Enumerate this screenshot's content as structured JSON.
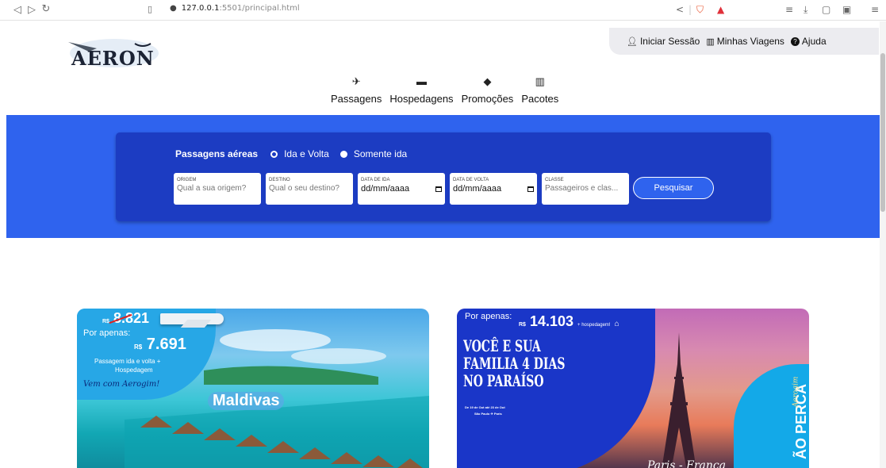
{
  "browser": {
    "url_host": "127.0.0.1",
    "url_path": ":5501/principal.html"
  },
  "topnav": {
    "login": "Iniciar Sessão",
    "trips": "Minhas Viagens",
    "help": "Ajuda"
  },
  "logo": {
    "text": "AERON"
  },
  "tabs": [
    {
      "label": "Passagens",
      "icon": "plane-icon"
    },
    {
      "label": "Hospedagens",
      "icon": "bed-icon"
    },
    {
      "label": "Promoções",
      "icon": "tag-icon"
    },
    {
      "label": "Pacotes",
      "icon": "suitcase-icon"
    }
  ],
  "search": {
    "title": "Passagens aéreas",
    "option_round": "Ida e Volta",
    "option_oneway": "Somente ida",
    "selected": "Somente ida",
    "origin_label": "ORIGEM",
    "origin_placeholder": "Qual a sua origem?",
    "destination_label": "DESTINO",
    "destination_placeholder": "Qual o seu destino?",
    "depart_label": "DATA DE IDA",
    "depart_value": "dd/mm/aaaa",
    "return_label": "DATA DE VOLTA",
    "return_value": "dd/mm/aaaa",
    "class_label": "CLASSE",
    "class_placeholder": "Passageiros e clas...",
    "button": "Pesquisar"
  },
  "promo1": {
    "old_currency": "R$",
    "old_price": "8.821",
    "por_apenas": "Por apenas:",
    "currency": "R$",
    "price": "7.691",
    "desc1": "Passagem ida e volta +",
    "desc2": "Hospedagem",
    "script": "Vem com Aerogim!",
    "destination": "Maldivas"
  },
  "promo2": {
    "por_apenas": "Por apenas:",
    "currency": "R$",
    "price": "14.103",
    "extra": "+ hospedagem!",
    "title1": "VOCÊ E SUA",
    "title2": "FAMILIA 4 DIAS",
    "title3": "NO PARAÍSO",
    "dates": "De 19 de Out até 23 de Out",
    "route": "São Paulo ✈ Paris",
    "side": "ÃO PERCA",
    "script": "Aerogim",
    "city": "Paris - França"
  },
  "colors": {
    "hero": "#2f63ee",
    "searchbox": "#1c3cc2",
    "topnav_bg": "#ececf0"
  }
}
